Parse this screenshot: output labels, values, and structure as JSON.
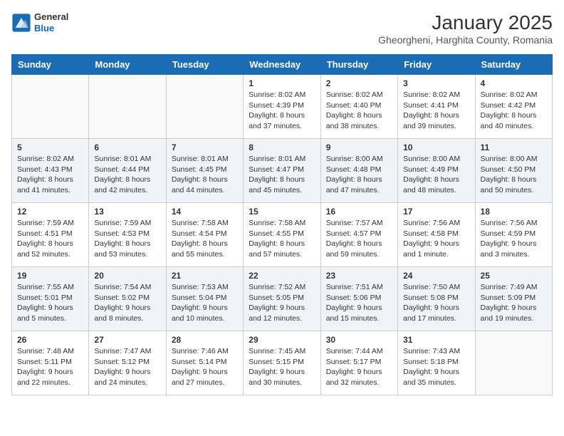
{
  "header": {
    "logo": {
      "line1": "General",
      "line2": "Blue"
    },
    "title": "January 2025",
    "subtitle": "Gheorgheni, Harghita County, Romania"
  },
  "days_of_week": [
    "Sunday",
    "Monday",
    "Tuesday",
    "Wednesday",
    "Thursday",
    "Friday",
    "Saturday"
  ],
  "weeks": [
    [
      {
        "day": "",
        "info": ""
      },
      {
        "day": "",
        "info": ""
      },
      {
        "day": "",
        "info": ""
      },
      {
        "day": "1",
        "info": "Sunrise: 8:02 AM\nSunset: 4:39 PM\nDaylight: 8 hours and 37 minutes."
      },
      {
        "day": "2",
        "info": "Sunrise: 8:02 AM\nSunset: 4:40 PM\nDaylight: 8 hours and 38 minutes."
      },
      {
        "day": "3",
        "info": "Sunrise: 8:02 AM\nSunset: 4:41 PM\nDaylight: 8 hours and 39 minutes."
      },
      {
        "day": "4",
        "info": "Sunrise: 8:02 AM\nSunset: 4:42 PM\nDaylight: 8 hours and 40 minutes."
      }
    ],
    [
      {
        "day": "5",
        "info": "Sunrise: 8:02 AM\nSunset: 4:43 PM\nDaylight: 8 hours and 41 minutes."
      },
      {
        "day": "6",
        "info": "Sunrise: 8:01 AM\nSunset: 4:44 PM\nDaylight: 8 hours and 42 minutes."
      },
      {
        "day": "7",
        "info": "Sunrise: 8:01 AM\nSunset: 4:45 PM\nDaylight: 8 hours and 44 minutes."
      },
      {
        "day": "8",
        "info": "Sunrise: 8:01 AM\nSunset: 4:47 PM\nDaylight: 8 hours and 45 minutes."
      },
      {
        "day": "9",
        "info": "Sunrise: 8:00 AM\nSunset: 4:48 PM\nDaylight: 8 hours and 47 minutes."
      },
      {
        "day": "10",
        "info": "Sunrise: 8:00 AM\nSunset: 4:49 PM\nDaylight: 8 hours and 48 minutes."
      },
      {
        "day": "11",
        "info": "Sunrise: 8:00 AM\nSunset: 4:50 PM\nDaylight: 8 hours and 50 minutes."
      }
    ],
    [
      {
        "day": "12",
        "info": "Sunrise: 7:59 AM\nSunset: 4:51 PM\nDaylight: 8 hours and 52 minutes."
      },
      {
        "day": "13",
        "info": "Sunrise: 7:59 AM\nSunset: 4:53 PM\nDaylight: 8 hours and 53 minutes."
      },
      {
        "day": "14",
        "info": "Sunrise: 7:58 AM\nSunset: 4:54 PM\nDaylight: 8 hours and 55 minutes."
      },
      {
        "day": "15",
        "info": "Sunrise: 7:58 AM\nSunset: 4:55 PM\nDaylight: 8 hours and 57 minutes."
      },
      {
        "day": "16",
        "info": "Sunrise: 7:57 AM\nSunset: 4:57 PM\nDaylight: 8 hours and 59 minutes."
      },
      {
        "day": "17",
        "info": "Sunrise: 7:56 AM\nSunset: 4:58 PM\nDaylight: 9 hours and 1 minute."
      },
      {
        "day": "18",
        "info": "Sunrise: 7:56 AM\nSunset: 4:59 PM\nDaylight: 9 hours and 3 minutes."
      }
    ],
    [
      {
        "day": "19",
        "info": "Sunrise: 7:55 AM\nSunset: 5:01 PM\nDaylight: 9 hours and 5 minutes."
      },
      {
        "day": "20",
        "info": "Sunrise: 7:54 AM\nSunset: 5:02 PM\nDaylight: 9 hours and 8 minutes."
      },
      {
        "day": "21",
        "info": "Sunrise: 7:53 AM\nSunset: 5:04 PM\nDaylight: 9 hours and 10 minutes."
      },
      {
        "day": "22",
        "info": "Sunrise: 7:52 AM\nSunset: 5:05 PM\nDaylight: 9 hours and 12 minutes."
      },
      {
        "day": "23",
        "info": "Sunrise: 7:51 AM\nSunset: 5:06 PM\nDaylight: 9 hours and 15 minutes."
      },
      {
        "day": "24",
        "info": "Sunrise: 7:50 AM\nSunset: 5:08 PM\nDaylight: 9 hours and 17 minutes."
      },
      {
        "day": "25",
        "info": "Sunrise: 7:49 AM\nSunset: 5:09 PM\nDaylight: 9 hours and 19 minutes."
      }
    ],
    [
      {
        "day": "26",
        "info": "Sunrise: 7:48 AM\nSunset: 5:11 PM\nDaylight: 9 hours and 22 minutes."
      },
      {
        "day": "27",
        "info": "Sunrise: 7:47 AM\nSunset: 5:12 PM\nDaylight: 9 hours and 24 minutes."
      },
      {
        "day": "28",
        "info": "Sunrise: 7:46 AM\nSunset: 5:14 PM\nDaylight: 9 hours and 27 minutes."
      },
      {
        "day": "29",
        "info": "Sunrise: 7:45 AM\nSunset: 5:15 PM\nDaylight: 9 hours and 30 minutes."
      },
      {
        "day": "30",
        "info": "Sunrise: 7:44 AM\nSunset: 5:17 PM\nDaylight: 9 hours and 32 minutes."
      },
      {
        "day": "31",
        "info": "Sunrise: 7:43 AM\nSunset: 5:18 PM\nDaylight: 9 hours and 35 minutes."
      },
      {
        "day": "",
        "info": ""
      }
    ]
  ]
}
